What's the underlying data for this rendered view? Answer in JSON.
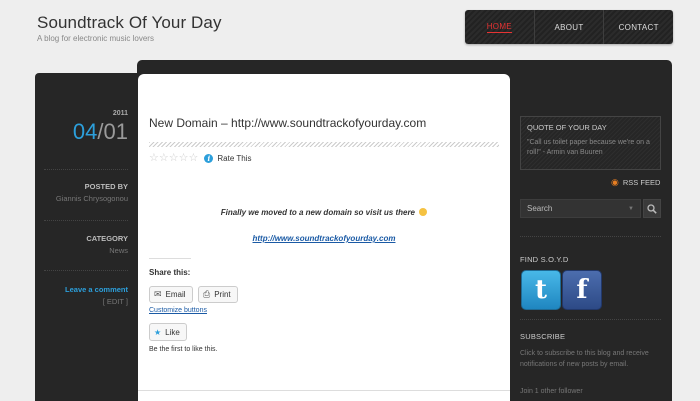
{
  "site": {
    "title": "Soundtrack Of Your Day",
    "tagline": "A blog for electronic music lovers"
  },
  "nav": {
    "items": [
      {
        "label": "HOME",
        "active": true
      },
      {
        "label": "ABOUT",
        "active": false
      },
      {
        "label": "CONTACT",
        "active": false
      }
    ]
  },
  "post": {
    "year": "2011",
    "month": "04",
    "separator": "/",
    "day": "01",
    "posted_by_label": "POSTED BY",
    "author": "Giannis Chrysogonou",
    "category_label": "CATEGORY",
    "category": "News",
    "comment_link": "Leave a comment",
    "edit_link": "[ EDIT ]",
    "title": "New Domain – http://www.soundtrackofyourday.com",
    "rate_label": "Rate This",
    "body_text": "Finally we moved to a new domain so visit us there",
    "body_link": "http://www.soundtrackofyourday.com"
  },
  "share": {
    "title": "Share this:",
    "email_label": "Email",
    "print_label": "Print",
    "customize_label": "Customize buttons",
    "like_label": "Like",
    "first_like": "Be the first to like this."
  },
  "sidebar": {
    "quote_title": "QUOTE OF YOUR DAY",
    "quote_text": "\"Call us toilet paper because we're on a roll!\" - Armin van Buuren",
    "rss_label": "RSS FEED",
    "search_placeholder": "Search",
    "find_title": "FIND S.O.Y.D",
    "subscribe_title": "SUBSCRIBE",
    "subscribe_text": "Click to subscribe to this blog and receive notifications of new posts by email.",
    "follower_text": "Join 1 other follower"
  },
  "colors": {
    "accent_blue": "#2c9fdb",
    "nav_active_red": "#e63333",
    "frame_dark": "#262626"
  }
}
